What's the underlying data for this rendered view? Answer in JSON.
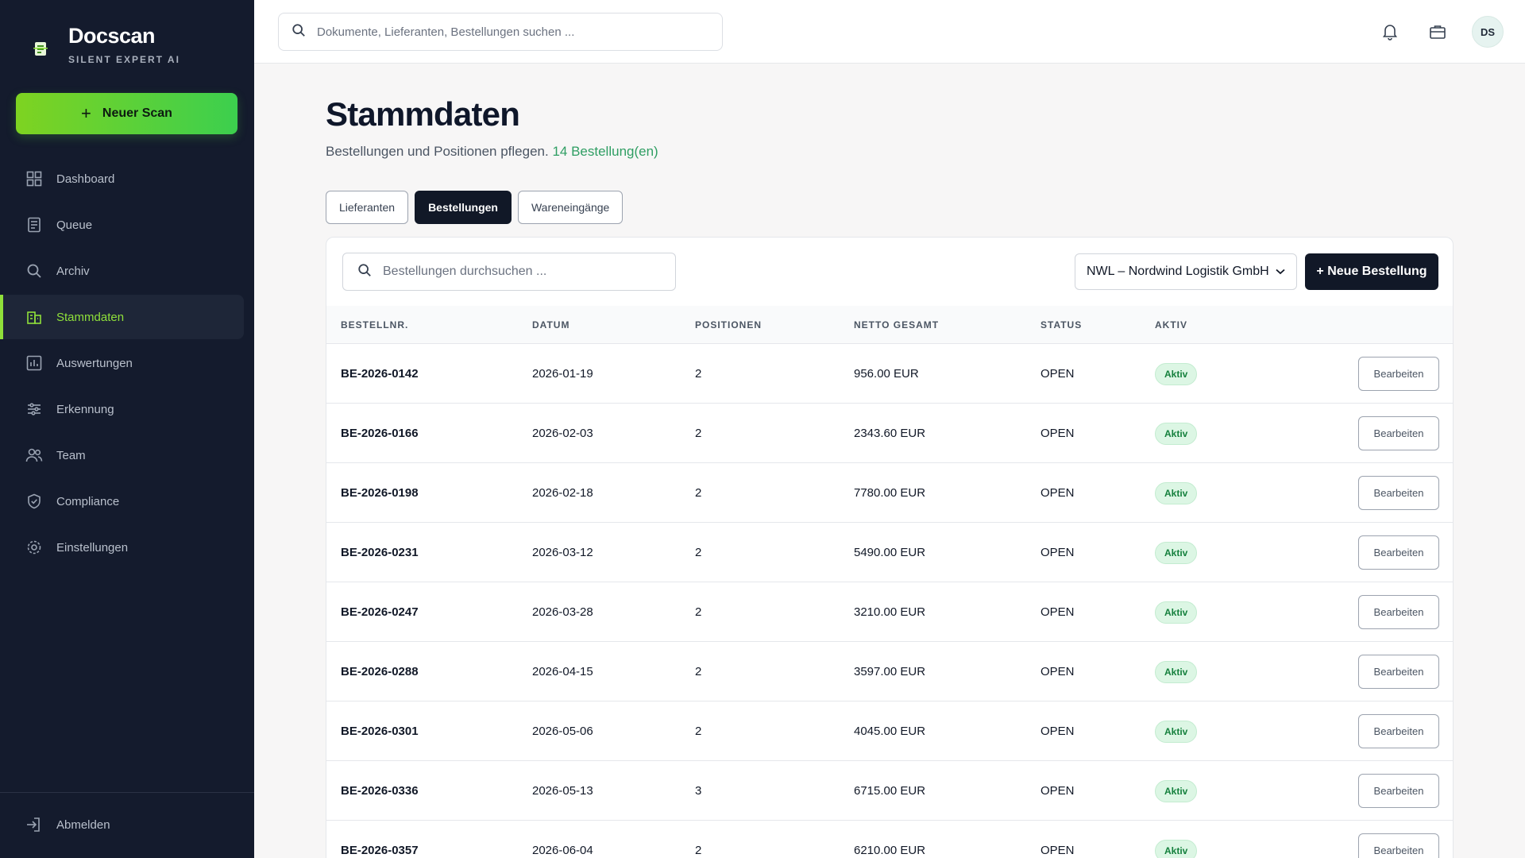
{
  "brand": {
    "name": "Docscan",
    "tagline": "SILENT EXPERT AI"
  },
  "sidebar": {
    "new_scan_label": "Neuer Scan",
    "items": [
      {
        "label": "Dashboard",
        "icon": "grid-icon",
        "active": false
      },
      {
        "label": "Queue",
        "icon": "list-doc-icon",
        "active": false
      },
      {
        "label": "Archiv",
        "icon": "search-icon",
        "active": false
      },
      {
        "label": "Stammdaten",
        "icon": "building-icon",
        "active": true
      },
      {
        "label": "Auswertungen",
        "icon": "chart-icon",
        "active": false
      },
      {
        "label": "Erkennung",
        "icon": "sliders-icon",
        "active": false
      },
      {
        "label": "Team",
        "icon": "users-icon",
        "active": false
      },
      {
        "label": "Compliance",
        "icon": "shield-check-icon",
        "active": false
      },
      {
        "label": "Einstellungen",
        "icon": "gear-icon",
        "active": false
      }
    ],
    "logout_label": "Abmelden"
  },
  "topbar": {
    "search_placeholder": "Dokumente, Lieferanten, Bestellungen suchen ...",
    "avatar_initials": "DS"
  },
  "page": {
    "title": "Stammdaten",
    "subtitle": "Bestellungen und Positionen pflegen.",
    "count_text": "14 Bestellung(en)",
    "tabs": [
      {
        "label": "Lieferanten",
        "active": false
      },
      {
        "label": "Bestellungen",
        "active": true
      },
      {
        "label": "Wareneingänge",
        "active": false
      }
    ]
  },
  "table": {
    "search_placeholder": "Bestellungen durchsuchen ...",
    "supplier_selected": "NWL – Nordwind Logistik GmbH",
    "new_button_label": "+ Neue Bestellung",
    "columns": [
      "BESTELLNR.",
      "DATUM",
      "POSITIONEN",
      "NETTO GESAMT",
      "STATUS",
      "AKTIV"
    ],
    "edit_label": "Bearbeiten",
    "rows": [
      {
        "order": "BE-2026-0142",
        "date": "2026-01-19",
        "positions": "2",
        "net": "956.00 EUR",
        "status": "OPEN",
        "active": "Aktiv"
      },
      {
        "order": "BE-2026-0166",
        "date": "2026-02-03",
        "positions": "2",
        "net": "2343.60 EUR",
        "status": "OPEN",
        "active": "Aktiv"
      },
      {
        "order": "BE-2026-0198",
        "date": "2026-02-18",
        "positions": "2",
        "net": "7780.00 EUR",
        "status": "OPEN",
        "active": "Aktiv"
      },
      {
        "order": "BE-2026-0231",
        "date": "2026-03-12",
        "positions": "2",
        "net": "5490.00 EUR",
        "status": "OPEN",
        "active": "Aktiv"
      },
      {
        "order": "BE-2026-0247",
        "date": "2026-03-28",
        "positions": "2",
        "net": "3210.00 EUR",
        "status": "OPEN",
        "active": "Aktiv"
      },
      {
        "order": "BE-2026-0288",
        "date": "2026-04-15",
        "positions": "2",
        "net": "3597.00 EUR",
        "status": "OPEN",
        "active": "Aktiv"
      },
      {
        "order": "BE-2026-0301",
        "date": "2026-05-06",
        "positions": "2",
        "net": "4045.00 EUR",
        "status": "OPEN",
        "active": "Aktiv"
      },
      {
        "order": "BE-2026-0336",
        "date": "2026-05-13",
        "positions": "3",
        "net": "6715.00 EUR",
        "status": "OPEN",
        "active": "Aktiv"
      },
      {
        "order": "BE-2026-0357",
        "date": "2026-06-04",
        "positions": "2",
        "net": "6210.00 EUR",
        "status": "OPEN",
        "active": "Aktiv"
      }
    ]
  },
  "colors": {
    "sidebar_bg": "#141b2d",
    "accent": "#8fe03a",
    "primary_dark": "#111827",
    "badge_bg": "#dcf6e4",
    "badge_text": "#15803d"
  }
}
